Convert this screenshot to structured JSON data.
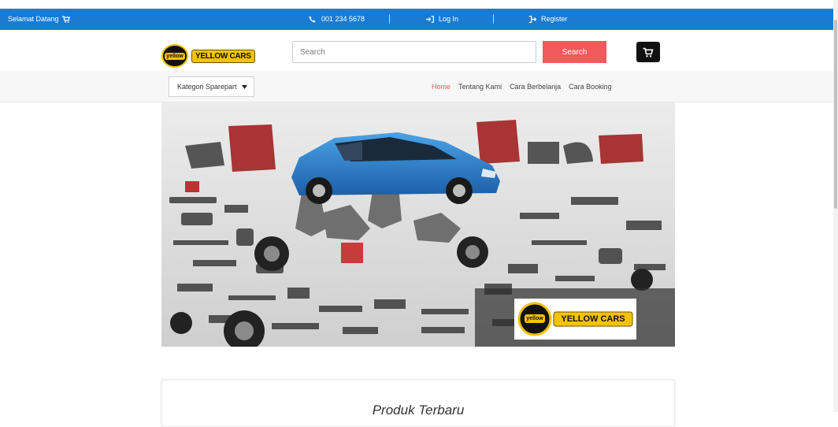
{
  "topbar": {
    "welcome": "Selamat Datang",
    "phone": "001 234 5678",
    "login": "Log In",
    "register": "Register"
  },
  "header": {
    "logo_badge": "yellow",
    "logo_text": "YELLOW CARS",
    "search_placeholder": "Search",
    "search_button": "Search"
  },
  "nav": {
    "category_select": "Kategori Sparepart",
    "links": [
      "Home",
      "Tentang Kami",
      "Cara Berbelanja",
      "Cara Booking"
    ]
  },
  "hero": {
    "logo_badge": "yellow",
    "logo_text": "YELLOW CARS"
  },
  "products": {
    "heading": "Produk Terbaru"
  },
  "colors": {
    "topbar": "#1a7bd3",
    "accent": "#f05a5a",
    "brand_yellow": "#f3c300"
  }
}
